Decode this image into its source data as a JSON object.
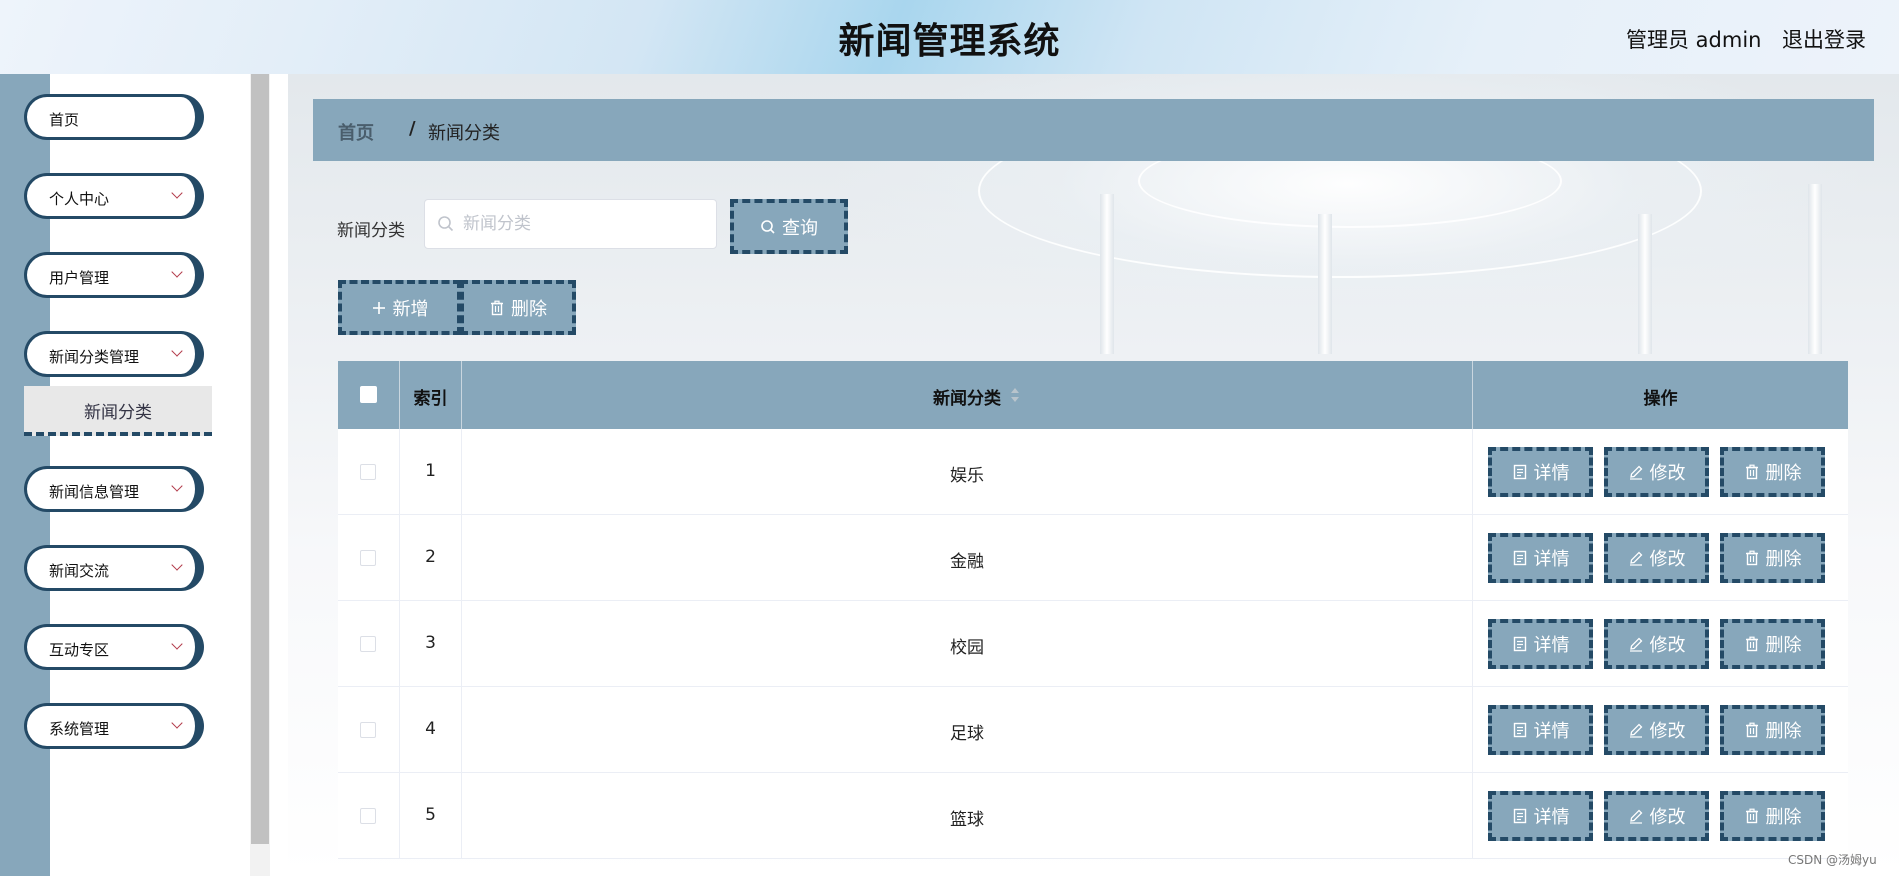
{
  "header": {
    "title": "新闻管理系统",
    "user": "管理员 admin",
    "logout": "退出登录"
  },
  "sidebar": {
    "items": [
      {
        "label": "首页",
        "has_chevron": false
      },
      {
        "label": "个人中心",
        "has_chevron": true
      },
      {
        "label": "用户管理",
        "has_chevron": true
      },
      {
        "label": "新闻分类管理",
        "has_chevron": true
      },
      {
        "label": "新闻信息管理",
        "has_chevron": true
      },
      {
        "label": "新闻交流",
        "has_chevron": true
      },
      {
        "label": "互动专区",
        "has_chevron": true
      },
      {
        "label": "系统管理",
        "has_chevron": true
      }
    ],
    "active_submenu": "新闻分类"
  },
  "breadcrumb": {
    "home": "首页",
    "separator": "/",
    "current": "新闻分类"
  },
  "search": {
    "label": "新闻分类",
    "placeholder": "新闻分类",
    "value": "",
    "button": "查询"
  },
  "toolbar": {
    "add": "新增",
    "delete": "删除"
  },
  "table": {
    "columns": {
      "index": "索引",
      "category": "新闻分类",
      "actions": "操作"
    },
    "rows": [
      {
        "index": "1",
        "category": "娱乐"
      },
      {
        "index": "2",
        "category": "金融"
      },
      {
        "index": "3",
        "category": "校园"
      },
      {
        "index": "4",
        "category": "足球"
      },
      {
        "index": "5",
        "category": "篮球"
      }
    ],
    "row_actions": {
      "detail": "详情",
      "edit": "修改",
      "delete": "删除"
    }
  },
  "watermark": "CSDN @汤姆yu",
  "colors": {
    "accent": "#87a7bb",
    "border_dark": "#244a66",
    "chevron": "#b23b4a"
  },
  "icons": [
    "search-icon",
    "plus-icon",
    "trash-icon",
    "document-icon",
    "edit-icon",
    "sort-icon",
    "chevron-down-icon"
  ]
}
